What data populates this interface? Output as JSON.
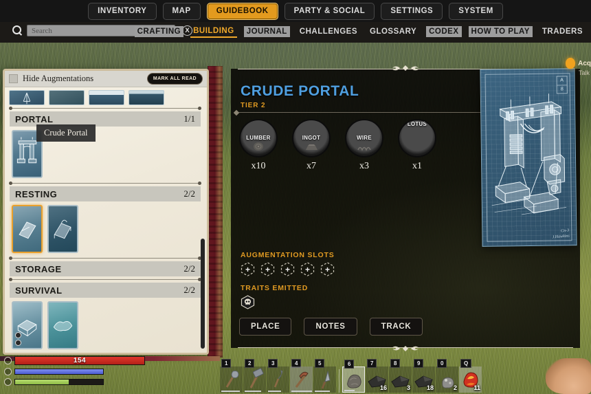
{
  "topnav": {
    "items": [
      {
        "label": "INVENTORY",
        "active": false
      },
      {
        "label": "MAP",
        "active": false
      },
      {
        "label": "GUIDEBOOK",
        "active": true
      },
      {
        "label": "PARTY & SOCIAL",
        "active": false
      },
      {
        "label": "SETTINGS",
        "active": false
      },
      {
        "label": "SYSTEM",
        "active": false
      }
    ]
  },
  "search": {
    "placeholder": "Search",
    "value": "",
    "icon": "search-icon",
    "clear_label": "X"
  },
  "subnav": {
    "items": [
      {
        "label": "CRAFTING",
        "state": "highlight"
      },
      {
        "label": "BUILDING",
        "state": "active"
      },
      {
        "label": "JOURNAL",
        "state": "highlight"
      },
      {
        "label": "CHALLENGES",
        "state": "normal"
      },
      {
        "label": "GLOSSARY",
        "state": "normal"
      },
      {
        "label": "CODEX",
        "state": "highlight"
      },
      {
        "label": "HOW TO PLAY",
        "state": "highlight"
      },
      {
        "label": "TRADERS",
        "state": "normal"
      }
    ]
  },
  "sidebar": {
    "hide_augmentations_label": "Hide Augmentations",
    "mark_all_read_label": "MARK ALL READ",
    "tooltip": "Crude Portal",
    "categories": [
      {
        "name": "PORTAL",
        "count": "1/1",
        "cards": [
          "Crude Portal"
        ]
      },
      {
        "name": "RESTING",
        "count": "2/2",
        "cards": [
          "Bedroll",
          "Bed"
        ]
      },
      {
        "name": "STORAGE",
        "count": "2/2",
        "cards": []
      },
      {
        "name": "SURVIVAL",
        "count": "2/2",
        "cards": [
          "Crate",
          "Rack"
        ]
      }
    ]
  },
  "detail": {
    "title": "CRUDE PORTAL",
    "tier": "TIER 2",
    "materials": [
      {
        "name": "LUMBER",
        "qty": "x10",
        "missing": true,
        "glyph": "log-icon"
      },
      {
        "name": "INGOT",
        "qty": "x7",
        "missing": true,
        "glyph": "ingot-icon"
      },
      {
        "name": "WIRE",
        "qty": "x3",
        "missing": true,
        "glyph": "wire-icon"
      },
      {
        "name": "SYNCHRONOUS LOTUS",
        "qty": "x1",
        "missing": true,
        "glyph": "lotus-icon"
      }
    ],
    "augmentation_slots_label": "AUGMENTATION SLOTS",
    "augmentation_slot_count": 5,
    "augmentation_slot_glyph": "+",
    "traits_emitted_label": "TRAITS EMITTED",
    "traits": [
      {
        "name": "skull-trait-icon"
      }
    ],
    "buttons": [
      {
        "label": "PLACE"
      },
      {
        "label": "NOTES"
      },
      {
        "label": "TRACK"
      }
    ]
  },
  "blueprint": {
    "corner_top": "A",
    "corner_bottom": "8",
    "signature_line1": "Cn-3",
    "signature_line2": "J.Hawkins"
  },
  "notification": {
    "title": "Acq",
    "subtitle": "Talk",
    "icon": "quest-orb-icon"
  },
  "hud": {
    "health": {
      "value": "154",
      "percent": 100
    },
    "mana": {
      "percent": 100
    },
    "stamina": {
      "percent": 61
    },
    "hotbar": [
      {
        "key": "1",
        "icon": "axe-icon",
        "count": "",
        "selected": false,
        "durability": 82
      },
      {
        "key": "2",
        "icon": "hammer-icon",
        "count": "",
        "selected": false,
        "durability": 74
      },
      {
        "key": "3",
        "icon": "sickle-icon",
        "count": "",
        "selected": false,
        "durability": 58
      },
      {
        "key": "4",
        "icon": "pickaxe-icon",
        "count": "",
        "selected": false,
        "durability": 90
      },
      {
        "key": "5",
        "icon": "knife-icon",
        "count": "",
        "selected": false,
        "durability": 66
      },
      {
        "key": "6",
        "icon": "rock-icon",
        "count": "",
        "selected": true,
        "durability": 48
      },
      {
        "key": "7",
        "icon": "stone-icon",
        "count": "16",
        "selected": false,
        "durability": 0
      },
      {
        "key": "8",
        "icon": "stone-icon",
        "count": "3",
        "selected": false,
        "durability": 0
      },
      {
        "key": "9",
        "icon": "stone-icon",
        "count": "18",
        "selected": false,
        "durability": 0
      },
      {
        "key": "0",
        "icon": "ore-icon",
        "count": "2",
        "selected": false,
        "durability": 0
      },
      {
        "key": "Q",
        "icon": "ember-icon",
        "count": "11",
        "selected": false,
        "durability": 0
      }
    ]
  },
  "colors": {
    "accent_gold": "#e39a1e",
    "title_blue": "#4f9fe0",
    "missing_red": "#d7423c",
    "health_red": "#e0372c",
    "mana_blue": "#7f8ff0",
    "stamina_green": "#b8de6f",
    "blueprint_blue": "#355a74"
  }
}
